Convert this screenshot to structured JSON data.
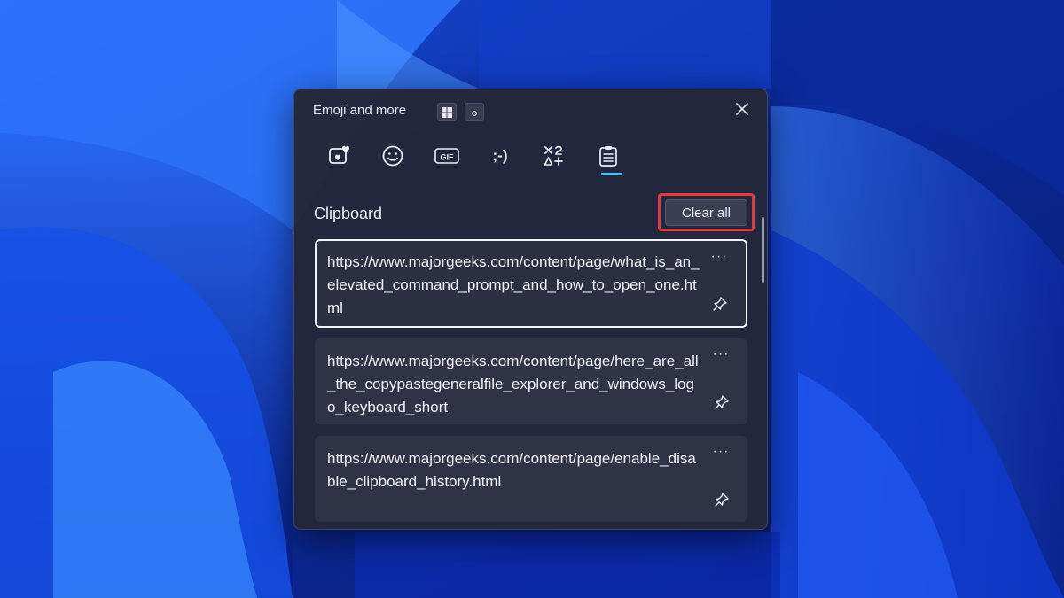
{
  "panel": {
    "title": "Emoji and more",
    "close_icon": "close-icon",
    "mini_buttons": [
      "windows-logo-icon",
      "small-circle-icon"
    ]
  },
  "tabs": [
    {
      "icon": "favorites-heart-icon"
    },
    {
      "icon": "emoji-smiley-icon"
    },
    {
      "icon": "gif-icon",
      "label": "GIF"
    },
    {
      "icon": "kaomoji-icon",
      "label": ";-)"
    },
    {
      "icon": "symbols-icon"
    },
    {
      "icon": "clipboard-icon",
      "active": true
    }
  ],
  "clipboard": {
    "title": "Clipboard",
    "clear_all_label": "Clear all",
    "items": [
      {
        "text": "https://www.majorgeeks.com/content/page/what_is_an_elevated_command_prompt_and_how_to_open_one.html",
        "more": "···",
        "selected": true
      },
      {
        "text": "https://www.majorgeeks.com/content/page/here_are_all_the_copypastegeneralfile_explorer_and_windows_logo_keyboard_short",
        "more": "···"
      },
      {
        "text": "https://www.majorgeeks.com/content/page/enable_disable_clipboard_history.html",
        "more": "···"
      }
    ]
  },
  "colors": {
    "accent": "#4cc2ff",
    "highlight_outline": "#e0393e",
    "panel_bg": "#24273a",
    "wallpaper": "#0a1a66"
  }
}
